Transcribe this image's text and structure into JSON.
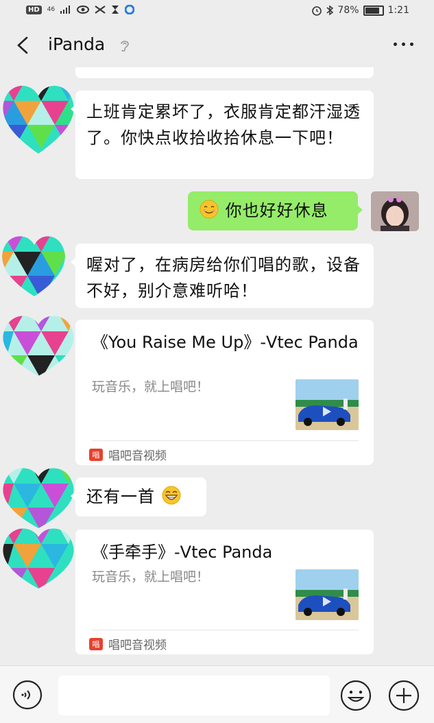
{
  "status_bar": {
    "network": "46",
    "battery_percent": "78%",
    "battery_level": 0.78,
    "time": "1:21"
  },
  "header": {
    "title": "iPanda",
    "back_icon": "chevron-left-icon",
    "more_icon": "more-dots-icon"
  },
  "messages": [
    {
      "side": "left",
      "type": "text",
      "text": "上班肯定累坏了，衣服肯定都汗湿透了。你快点收拾收拾休息一下吧！"
    },
    {
      "side": "right",
      "type": "text",
      "text": "你也好好休息",
      "emoji": "smile-emoji"
    },
    {
      "side": "left",
      "type": "text",
      "text": "喔对了，在病房给你们唱的歌，设备不好，别介意难听哈！"
    },
    {
      "side": "left",
      "type": "card",
      "title": "《You Raise Me Up》-Vtec Panda",
      "desc": "玩音乐，就上唱吧！",
      "source": "唱吧音视频",
      "source_icon": "唱"
    },
    {
      "side": "left",
      "type": "text",
      "text": "还有一首",
      "emoji": "grin-emoji"
    },
    {
      "side": "left",
      "type": "card",
      "title": "《手牵手》-Vtec Panda",
      "desc": "玩音乐，就上唱吧！",
      "source": "唱吧音视频",
      "source_icon": "唱"
    }
  ],
  "input_bar": {
    "placeholder": "",
    "voice_icon": "voice-icon",
    "emoji_icon": "emoji-icon",
    "plus_icon": "plus-icon"
  },
  "colors": {
    "background": "#ededed",
    "self_bubble": "#95ec69",
    "other_bubble": "#ffffff",
    "source_icon": "#e8412c"
  }
}
